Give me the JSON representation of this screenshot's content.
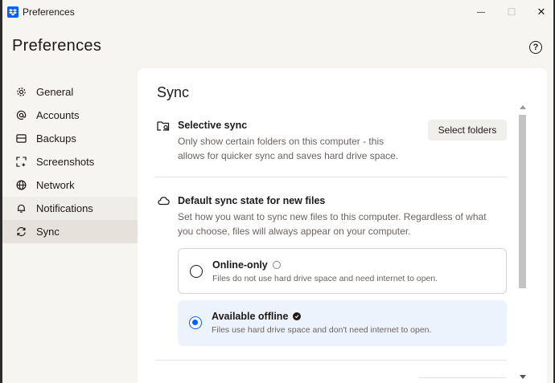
{
  "window": {
    "title": "Preferences",
    "minimize_glyph": "—",
    "maximize_glyph": "☐",
    "close_glyph": "✕"
  },
  "header": {
    "title": "Preferences",
    "help_glyph": "?"
  },
  "sidebar": {
    "items": [
      {
        "label": "General",
        "icon": "gear-icon"
      },
      {
        "label": "Accounts",
        "icon": "at-icon"
      },
      {
        "label": "Backups",
        "icon": "backup-icon"
      },
      {
        "label": "Screenshots",
        "icon": "screenshot-icon"
      },
      {
        "label": "Network",
        "icon": "globe-icon"
      },
      {
        "label": "Notifications",
        "icon": "bell-icon"
      },
      {
        "label": "Sync",
        "icon": "sync-icon"
      }
    ],
    "active": "Sync"
  },
  "main": {
    "title": "Sync",
    "selective_sync": {
      "title": "Selective sync",
      "description_line1": "Only show certain folders on this computer - this",
      "description_line2": "allows for quicker sync and saves hard drive space.",
      "button_label": "Select folders"
    },
    "default_state": {
      "title": "Default sync state for new files",
      "description_line1": "Set how you want to sync new files to this computer. Regardless of what",
      "description_line2": "you choose, files will always appear on your computer.",
      "options": [
        {
          "title": "Online-only",
          "description": "Files do not use hard drive space and need internet to open.",
          "selected": false
        },
        {
          "title": "Available offline",
          "description": "Files use hard drive space and don't need internet to open.",
          "selected": true
        }
      ]
    }
  },
  "colors": {
    "accent": "#0061fe",
    "selected_bg": "#edf3fd",
    "sidebar_active": "#e6e1da"
  }
}
